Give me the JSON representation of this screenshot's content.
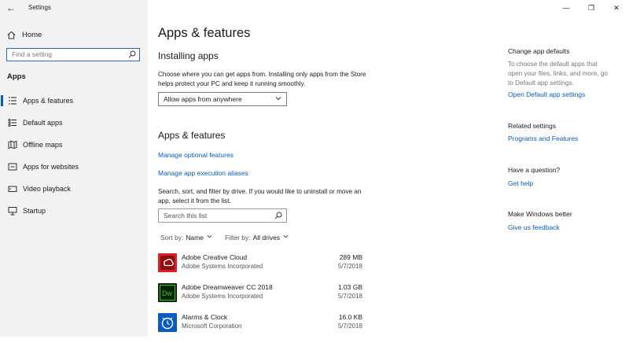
{
  "window": {
    "title": "Settings",
    "back_glyph": "←",
    "minimize_glyph": "—",
    "maximize_glyph": "❐",
    "close_glyph": "✕"
  },
  "sidebar": {
    "home_label": "Home",
    "search_placeholder": "Find a setting",
    "section": "Apps",
    "items": [
      {
        "label": "Apps & features",
        "icon": "apps-features-icon",
        "active": true
      },
      {
        "label": "Default apps",
        "icon": "default-apps-icon",
        "active": false
      },
      {
        "label": "Offline maps",
        "icon": "offline-maps-icon",
        "active": false
      },
      {
        "label": "Apps for websites",
        "icon": "apps-for-websites-icon",
        "active": false
      },
      {
        "label": "Video playback",
        "icon": "video-playback-icon",
        "active": false
      },
      {
        "label": "Startup",
        "icon": "startup-icon",
        "active": false
      }
    ]
  },
  "main": {
    "title": "Apps & features",
    "installing": {
      "heading": "Installing apps",
      "description": "Choose where you can get apps from. Installing only apps from the Store helps protect your PC and keep it running smoothly.",
      "dropdown_value": "Allow apps from anywhere"
    },
    "features": {
      "heading": "Apps & features",
      "link_optional": "Manage optional features",
      "link_aliases": "Manage app execution aliases",
      "description": "Search, sort, and filter by drive. If you would like to uninstall or move an app, select it from the list.",
      "search_placeholder": "Search this list",
      "sort_key": "Sort by:",
      "sort_value": "Name",
      "filter_key": "Filter by:",
      "filter_value": "All drives"
    },
    "apps": [
      {
        "name": "Adobe Creative Cloud",
        "publisher": "Adobe Systems Incorporated",
        "size": "289 MB",
        "date": "5/7/2018",
        "icon": "adobe-creative-cloud-icon",
        "icon_color": "#da1f26"
      },
      {
        "name": "Adobe Dreamweaver CC 2018",
        "publisher": "Adobe Systems Incorporated",
        "size": "1.03 GB",
        "date": "5/7/2018",
        "icon": "dreamweaver-icon",
        "icon_color": "#072401"
      },
      {
        "name": "Alarms & Clock",
        "publisher": "Microsoft Corporation",
        "size": "16.0 KB",
        "date": "5/7/2018",
        "icon": "alarms-clock-icon",
        "icon_color": "#0a5bbf"
      }
    ]
  },
  "right": {
    "defaults_heading": "Change app defaults",
    "defaults_text": "To choose the default apps that open your files, links, and more, go to Default app settings.",
    "defaults_link": "Open Default app settings",
    "related_heading": "Related settings",
    "related_link": "Programs and Features",
    "question_heading": "Have a question?",
    "question_link": "Get help",
    "better_heading": "Make Windows better",
    "better_link": "Give us feedback"
  },
  "colors": {
    "accent": "#0a5bbf",
    "sidebar_bg": "#f2f2f2",
    "search_border": "#2d64c8"
  }
}
